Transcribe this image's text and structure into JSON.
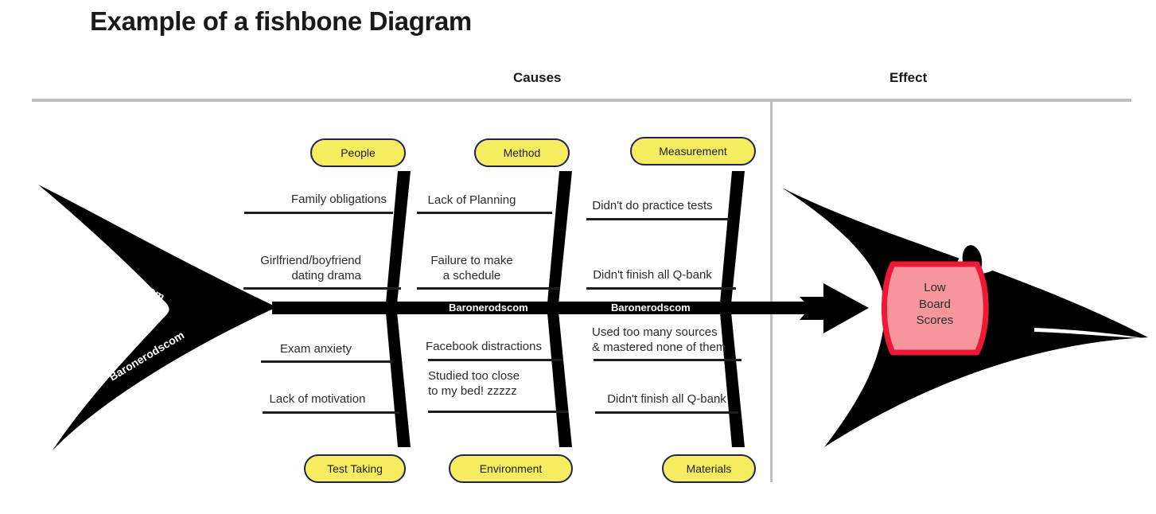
{
  "title": "Example of a fishbone Diagram",
  "sections": {
    "causes_label": "Causes",
    "effect_label": "Effect"
  },
  "colors": {
    "pill_fill": "#F6EC5F",
    "pill_border": "#1F2455",
    "fish_body": "#000000",
    "effect_fill": "#F4969B",
    "effect_border": "#F01837",
    "rule_gray": "#BFBFBF",
    "text": "#2B2B2B"
  },
  "categories": [
    {
      "id": "people",
      "label": "People",
      "position": "top",
      "group": 1
    },
    {
      "id": "method",
      "label": "Method",
      "position": "top",
      "group": 2
    },
    {
      "id": "measurement",
      "label": "Measurement",
      "position": "top",
      "group": 3
    },
    {
      "id": "test-taking",
      "label": "Test Taking",
      "position": "bottom",
      "group": 1
    },
    {
      "id": "environment",
      "label": "Environment",
      "position": "bottom",
      "group": 2
    },
    {
      "id": "materials",
      "label": "Materials",
      "position": "bottom",
      "group": 3
    }
  ],
  "causes": {
    "people": [
      "Family obligations",
      "Girlfriend/boyfriend\ndating drama"
    ],
    "method": [
      "Lack of Planning",
      "Failure to make\na schedule"
    ],
    "measurement": [
      "Didn't do practice tests",
      "Didn't finish all Q-bank"
    ],
    "test_taking": [
      "Exam anxiety",
      "Lack of motivation"
    ],
    "environment": [
      "Facebook distractions",
      "Studied too close\nto my bed! zzzzz"
    ],
    "materials": [
      "Used too many sources\n& mastered none of them",
      "Didn't finish all Q-bank"
    ]
  },
  "effect": {
    "text": "Low\nBoard\nScores"
  },
  "watermarks": {
    "tail_upper": "Baronerodscom",
    "tail_lower": "Baronerodscom",
    "spine_left": "Baronerodscom",
    "spine_right": "Baronerodscom"
  }
}
